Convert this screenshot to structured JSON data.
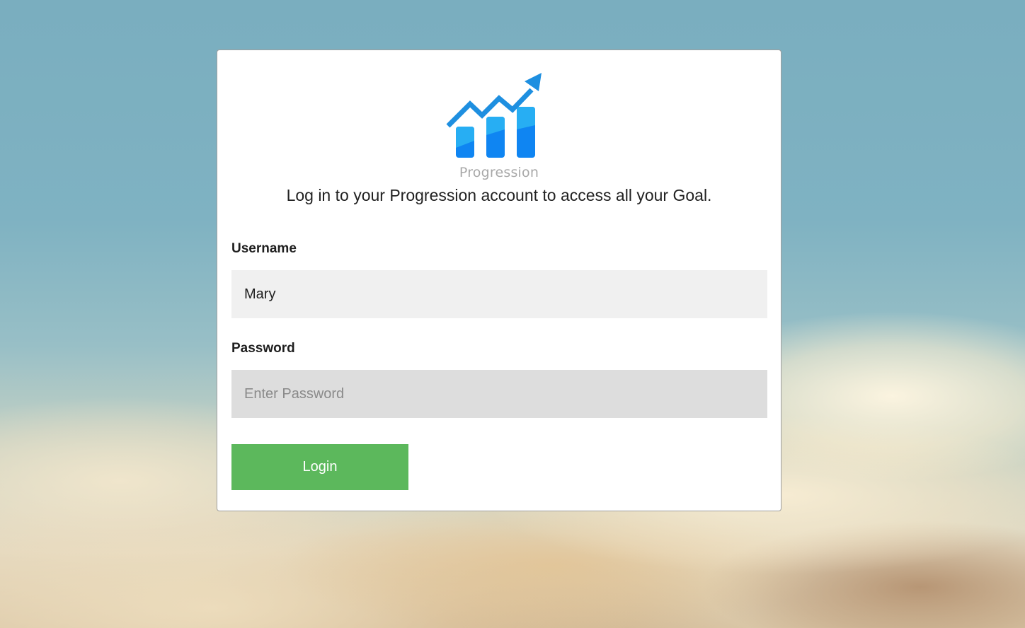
{
  "brand": {
    "name": "Progression",
    "icon": "growth-chart-icon",
    "colors": {
      "primary": "#1e8fe0",
      "bar_light": "#2bb3f3",
      "bar_dark": "#0f7ff2"
    }
  },
  "tagline": "Log in to your Progression account to access all your Goal.",
  "form": {
    "username_label": "Username",
    "username_value": "Mary",
    "password_label": "Password",
    "password_placeholder": "Enter Password",
    "password_value": "",
    "login_label": "Login",
    "login_color": "#5cb85c"
  }
}
